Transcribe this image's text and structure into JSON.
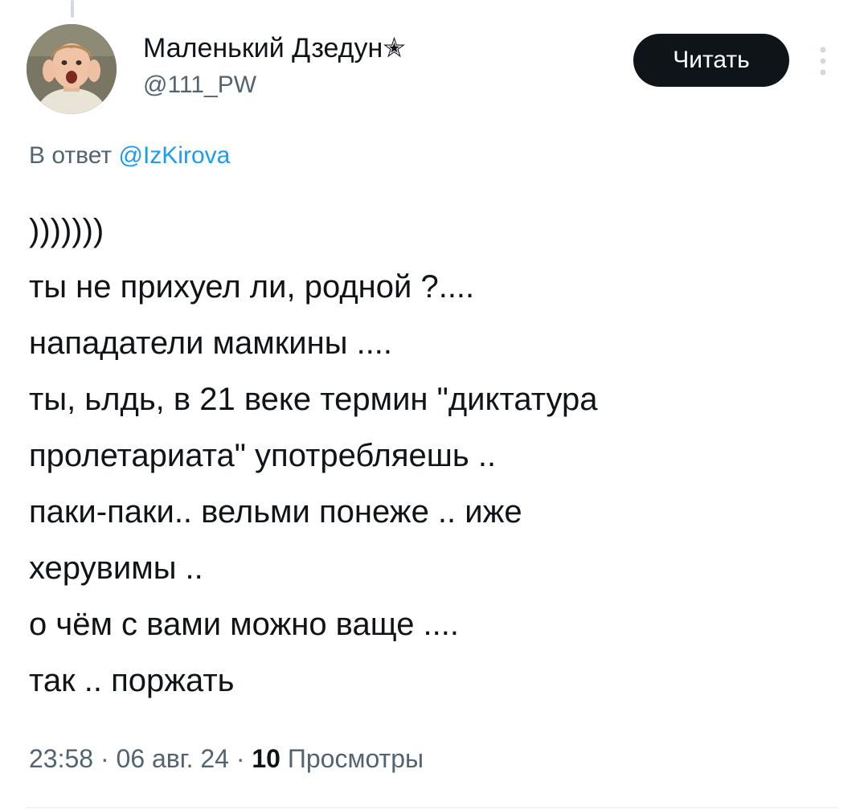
{
  "author": {
    "display_name": "Маленький Дзедун✭",
    "handle": "@111_PW",
    "avatar_icon": "avatar-photo"
  },
  "follow_button": {
    "label": "Читать"
  },
  "more_menu": {
    "icon": "more-vertical-icon"
  },
  "reply_context": {
    "prefix": "В ответ",
    "mention": "@IzKirova"
  },
  "tweet": {
    "lines": [
      ")))))))",
      "ты не прихуел ли, родной ?....",
      "нападатели мамкины ....",
      "ты, ьлдь, в 21 веке термин \"диктатура",
      "пролетариата\" употребляешь ..",
      "паки-паки.. вельми понеже .. иже",
      "херувимы ..",
      "о чём с вами можно ваще ....",
      "так .. поржать"
    ]
  },
  "meta": {
    "time": "23:58",
    "date": "06 авг. 24",
    "separator": " · ",
    "views_count": "10",
    "views_label": "Просмотры"
  },
  "colors": {
    "text_primary": "#0f1419",
    "text_secondary": "#536471",
    "accent": "#1d9bf0",
    "button_bg": "#0f1419",
    "divider": "#eff3f4"
  }
}
